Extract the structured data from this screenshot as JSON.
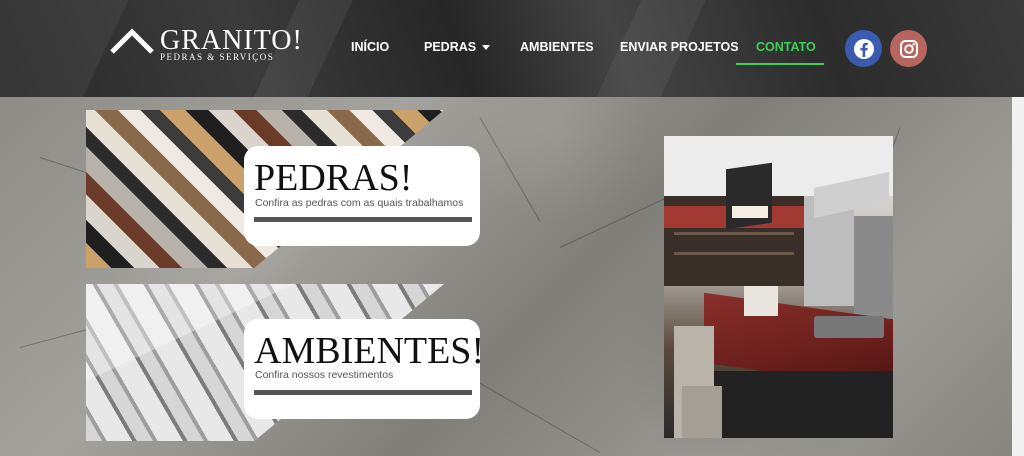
{
  "brand": {
    "title": "GRANITO!",
    "subtitle": "PEDRAS & SERVIÇOS"
  },
  "nav": {
    "items": [
      {
        "label": "INÍCIO"
      },
      {
        "label": "PEDRAS"
      },
      {
        "label": "AMBIENTES"
      },
      {
        "label": "ENVIAR PROJETOS"
      },
      {
        "label": "CONTATO"
      }
    ],
    "active": "CONTATO"
  },
  "social": {
    "icons": [
      "facebook-icon",
      "instagram-icon"
    ],
    "facebook_color": "#3b5bb0",
    "instagram_color": "#b6655f"
  },
  "cards": {
    "pedras": {
      "title": "PEDRAS!",
      "subtitle": "Confira as pedras com as quais trabalhamos"
    },
    "ambientes": {
      "title": "AMBIENTES!",
      "subtitle": "Confira nossos revestimentos"
    }
  },
  "colors": {
    "accent": "#3ecf5a",
    "header_bg": "#2f2f2f"
  }
}
